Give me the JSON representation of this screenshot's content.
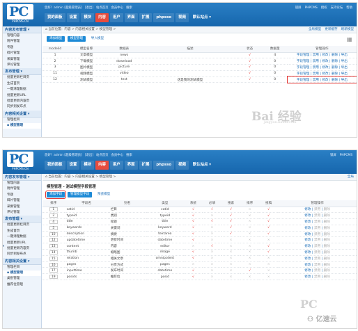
{
  "brand": {
    "logo_text": "PC",
    "logo_sub": "PHPCMS.CN"
  },
  "top_links": [
    "您好！admin [超级管理员]",
    "[退出]",
    "站点首页",
    "会员中心",
    "搜索"
  ],
  "top_right_1": [
    "锁屏",
    "PHPCMS",
    "授权",
    "支持论坛",
    "帮助"
  ],
  "top_right_2": [
    "锁屏",
    "PHPCMS"
  ],
  "nav_items": [
    "我的面板",
    "设置",
    "模块",
    "内容",
    "用户",
    "界面",
    "扩展",
    "phpsso",
    "视频",
    "默认站点 ▾"
  ],
  "nav_active": "内容",
  "shot1": {
    "sidebar": {
      "sections": [
        {
          "title": "内容发布管理 ▾",
          "items": [
            "管理内容",
            "附件管理",
            "专题",
            "碎片管理",
            "采集管理",
            "评论管理"
          ]
        },
        {
          "title": "发布管理 ▾",
          "items": [
            "批量更新栏目页",
            "生成首页",
            "一键清理数据",
            "批量更新URL",
            "批量更新内容页",
            "同步到发布点"
          ]
        },
        {
          "title": "内容相关设置 ▾",
          "items": [
            "管理栏目",
            "▪ 模型管理"
          ]
        }
      ],
      "active_item": "▪ 模型管理"
    },
    "crumb": "⌂ 当前位置：内容 > 内容相关设置 > 模型管理 >",
    "crumb_right": [
      "全局模型",
      "更新缓存",
      "刷新模型"
    ],
    "buttons": [
      "添加模型",
      "模型管理",
      "导入模型"
    ],
    "table_headers": [
      "modelid",
      "模型名称",
      "数据表",
      "描述",
      "状态",
      "数据量",
      "管理操作"
    ],
    "rows": [
      {
        "id": "1",
        "name": "文章模型",
        "table": "news",
        "desc": "",
        "status": "√",
        "count": "4",
        "ops": "字段管理 | 禁用 | 修改 | 删除 | 导出"
      },
      {
        "id": "2",
        "name": "下载模型",
        "table": "download",
        "desc": "",
        "status": "√",
        "count": "0",
        "ops": "字段管理 | 禁用 | 修改 | 删除 | 导出"
      },
      {
        "id": "3",
        "name": "图片模型",
        "table": "picture",
        "desc": "",
        "status": "√",
        "count": "0",
        "ops": "字段管理 | 禁用 | 修改 | 删除 | 导出"
      },
      {
        "id": "11",
        "name": "视频模型",
        "table": "video",
        "desc": "",
        "status": "√",
        "count": "0",
        "ops": "字段管理 | 禁用 | 修改 | 删除 | 导出"
      },
      {
        "id": "12",
        "name": "测试模型",
        "table": "test",
        "desc": "这是我的测试模型",
        "status": "√",
        "count": "0",
        "ops": "字段管理 | 禁用 | 修改 | 删除 | 导出"
      }
    ],
    "watermark": "Bai 经验",
    "watermark_sub": "jingyan.baidu.com"
  },
  "shot2": {
    "sidebar": {
      "sections": [
        {
          "title": "内容发布管理 ▾",
          "items": [
            "管理内容",
            "附件管理",
            "专题",
            "碎片管理",
            "采集管理",
            "评论管理"
          ]
        },
        {
          "title": "发布管理 ▾",
          "items": [
            "批量更新栏目页",
            "生成首页",
            "一键清理数据",
            "批量更新URL",
            "批量更新内容页",
            "同步到发布点"
          ]
        },
        {
          "title": "内容相关设置 ▾",
          "items": [
            "管理栏目",
            "▪ 模型管理",
            "类别管理",
            "推荐位管理"
          ]
        }
      ],
      "active_item": "▪ 模型管理"
    },
    "crumb": "⌂ 当前位置：内容 > 内容相关设置 > 模型管理 >",
    "crumb_right": "全局",
    "title": "模型管理 - 测试模型字段管理",
    "buttons": [
      "添加字段",
      "管理模型字段",
      "预览模型"
    ],
    "table_headers": [
      "排序",
      "字段名",
      "别名",
      "类型",
      "系统",
      "必填",
      "搜索",
      "排序",
      "投稿",
      "管理操作"
    ],
    "rows": [
      {
        "ord": "1",
        "field": "catid",
        "alias": "栏目",
        "type": "catid",
        "flags": [
          "√",
          "√",
          "√",
          "×",
          "√"
        ]
      },
      {
        "ord": "2",
        "field": "typeid",
        "alias": "类别",
        "type": "typeid",
        "flags": [
          "√",
          "×",
          "√",
          "×",
          "√"
        ]
      },
      {
        "ord": "4",
        "field": "title",
        "alias": "标题",
        "type": "title",
        "flags": [
          "√",
          "√",
          "√",
          "×",
          "√"
        ]
      },
      {
        "ord": "5",
        "field": "keywords",
        "alias": "关键词",
        "type": "keyword",
        "flags": [
          "√",
          "×",
          "√",
          "×",
          "√"
        ]
      },
      {
        "ord": "10",
        "field": "description",
        "alias": "摘要",
        "type": "textarea",
        "flags": [
          "√",
          "×",
          "√",
          "×",
          "√"
        ]
      },
      {
        "ord": "12",
        "field": "updatetime",
        "alias": "更新时间",
        "type": "datetime",
        "flags": [
          "√",
          "×",
          "×",
          "×",
          "×"
        ]
      },
      {
        "ord": "13",
        "field": "content",
        "alias": "内容",
        "type": "editor",
        "flags": [
          "×",
          "√",
          "×",
          "×",
          "√"
        ]
      },
      {
        "ord": "14",
        "field": "thumb",
        "alias": "缩略图",
        "type": "image",
        "flags": [
          "√",
          "×",
          "×",
          "×",
          "√"
        ]
      },
      {
        "ord": "15",
        "field": "relation",
        "alias": "相关文章",
        "type": "omnipotent",
        "flags": [
          "√",
          "×",
          "×",
          "×",
          "×"
        ]
      },
      {
        "ord": "16",
        "field": "pages",
        "alias": "分页方式",
        "type": "pages",
        "flags": [
          "×",
          "×",
          "×",
          "×",
          "×"
        ]
      },
      {
        "ord": "17",
        "field": "inputtime",
        "alias": "发布时间",
        "type": "datetime",
        "flags": [
          "√",
          "×",
          "×",
          "√",
          "×"
        ]
      },
      {
        "ord": "19",
        "field": "posids",
        "alias": "推荐位",
        "type": "posid",
        "flags": [
          "√",
          "×",
          "×",
          "×",
          "×"
        ]
      }
    ],
    "ops": [
      "修改",
      "禁用",
      "删除"
    ],
    "watermark": "PC",
    "watermark_sub": "⚇ 亿速云"
  },
  "colors": {
    "header": "#1666ad",
    "nav_active": "#e84c3d",
    "check": "#e53935",
    "button": "#1d8ad6",
    "highlight": "#e53935"
  }
}
